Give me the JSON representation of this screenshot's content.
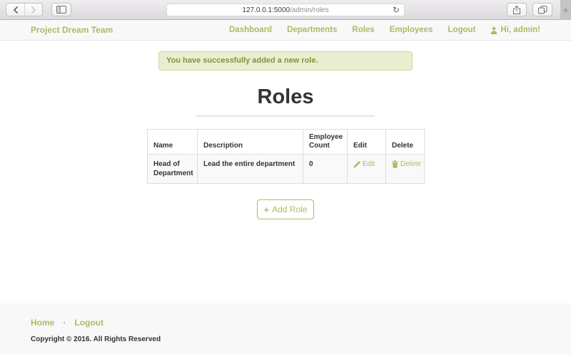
{
  "browser": {
    "url_host": "127.0.0.1:5000",
    "url_path": "/admin/roles"
  },
  "navbar": {
    "brand": "Project Dream Team",
    "links": [
      "Dashboard",
      "Departments",
      "Roles",
      "Employees",
      "Logout"
    ],
    "greeting": "Hi, admin!"
  },
  "alert": {
    "message": "You have successfully added a new role."
  },
  "page": {
    "title": "Roles"
  },
  "table": {
    "headers": [
      "Name",
      "Description",
      "Employee Count",
      "Edit",
      "Delete"
    ],
    "rows": [
      {
        "name": "Head of Department",
        "description": "Lead the entire department",
        "employee_count": "0",
        "edit": "Edit",
        "delete": "Delete"
      }
    ]
  },
  "add_button": {
    "label": "Add Role"
  },
  "footer": {
    "home": "Home",
    "separator": "·",
    "logout": "Logout",
    "copyright": "Copyright © 2016. All Rights Reserved"
  },
  "icons": {
    "refresh": "↻",
    "plus": "+"
  },
  "colors": {
    "accent": "#a9bc64",
    "alert_bg": "#e9eed0",
    "alert_border": "#cbd79c",
    "alert_text": "#7d9444",
    "navbar_bg": "#f8f8f8",
    "footer_bg": "#f8f8f8"
  }
}
